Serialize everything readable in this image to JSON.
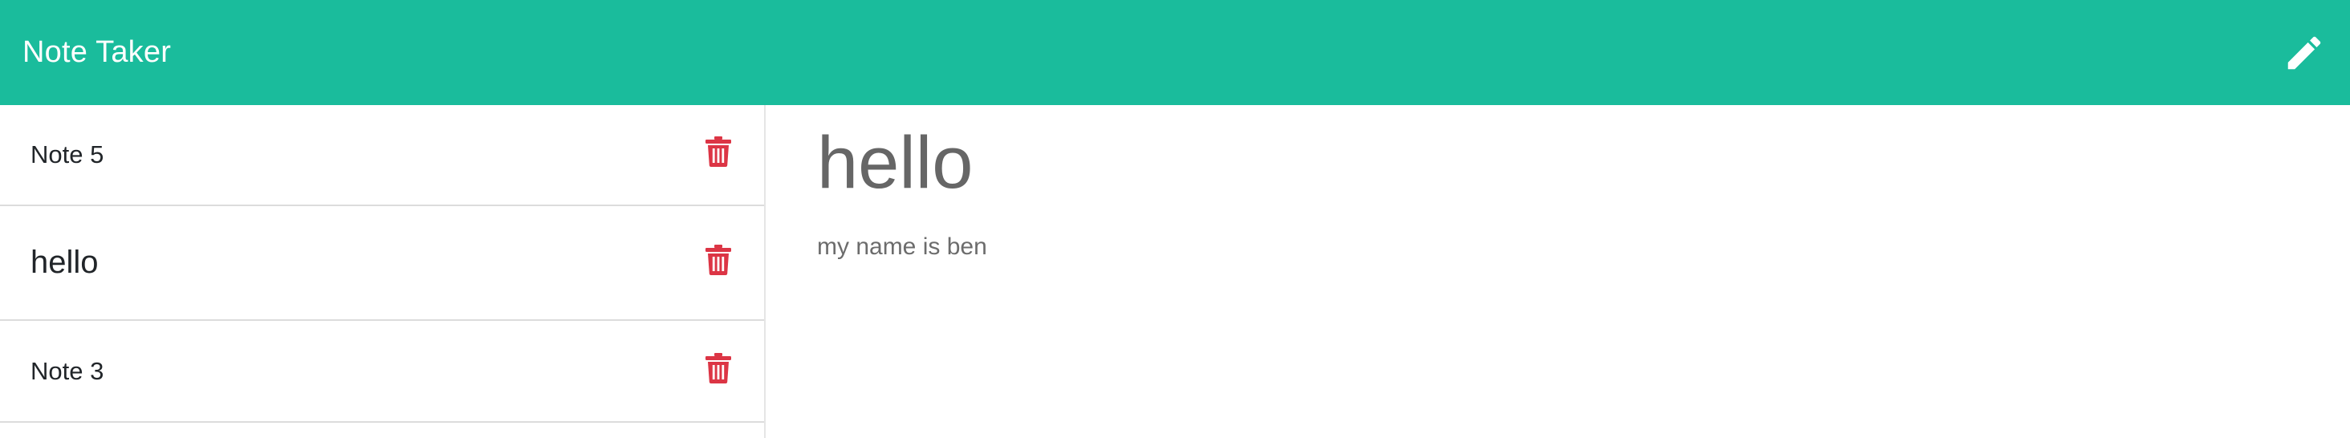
{
  "app": {
    "title": "Note Taker",
    "accent_color": "#1abc9c",
    "danger_color": "#dc3545",
    "new_note_icon": "pencil-icon"
  },
  "notes": [
    {
      "title": "Note 5",
      "delete_icon": "trash-icon"
    },
    {
      "title": "hello",
      "delete_icon": "trash-icon"
    },
    {
      "title": "Note 3",
      "delete_icon": "trash-icon"
    }
  ],
  "editor": {
    "title": "hello",
    "body": "my name is ben"
  }
}
